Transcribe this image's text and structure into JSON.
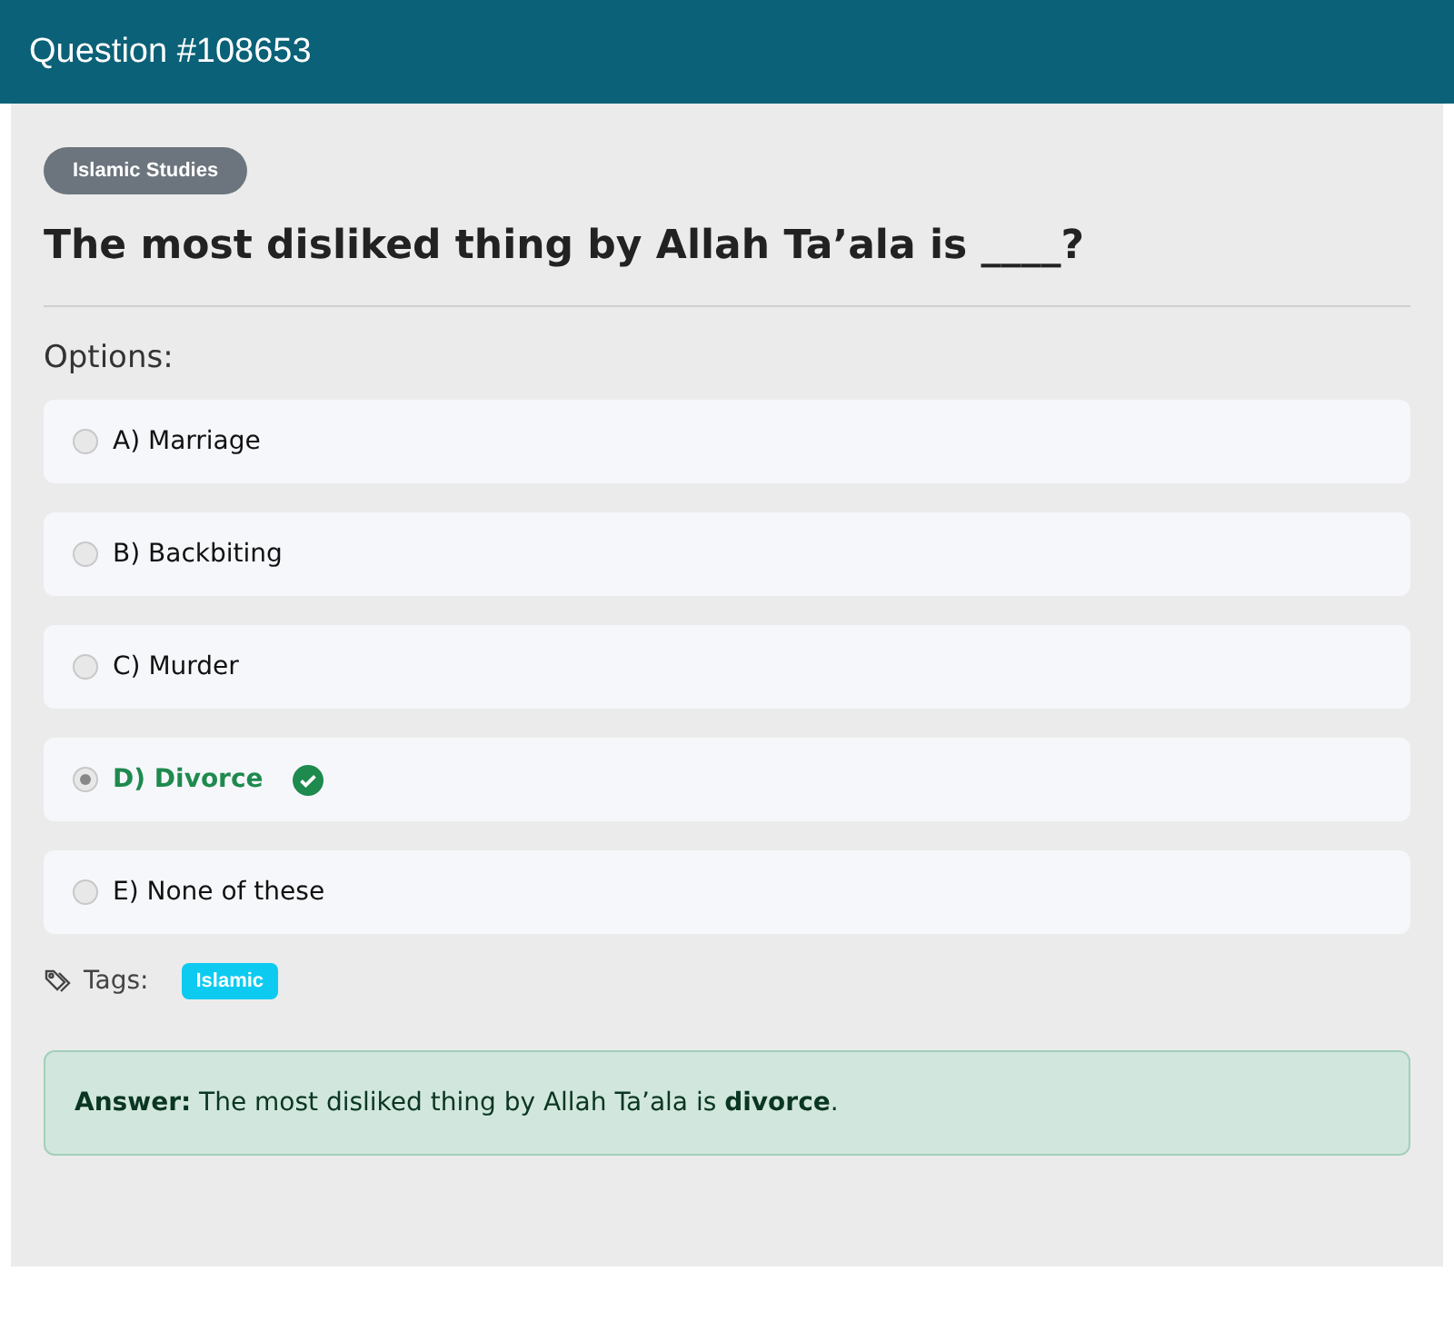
{
  "header": {
    "title": "Question #108653"
  },
  "category": "Islamic Studies",
  "question": "The most disliked thing by Allah Ta’ala is ____?",
  "options_label": "Options:",
  "options": [
    {
      "label": "A) Marriage",
      "selected": false,
      "correct": false
    },
    {
      "label": "B) Backbiting",
      "selected": false,
      "correct": false
    },
    {
      "label": "C) Murder",
      "selected": false,
      "correct": false
    },
    {
      "label": "D) Divorce",
      "selected": true,
      "correct": true
    },
    {
      "label": "E) None of these",
      "selected": false,
      "correct": false
    }
  ],
  "tags_label": "Tags:",
  "tags": [
    "Islamic"
  ],
  "answer": "**Answer:** The most disliked thing by Allah Ta’ala is **divorce**."
}
